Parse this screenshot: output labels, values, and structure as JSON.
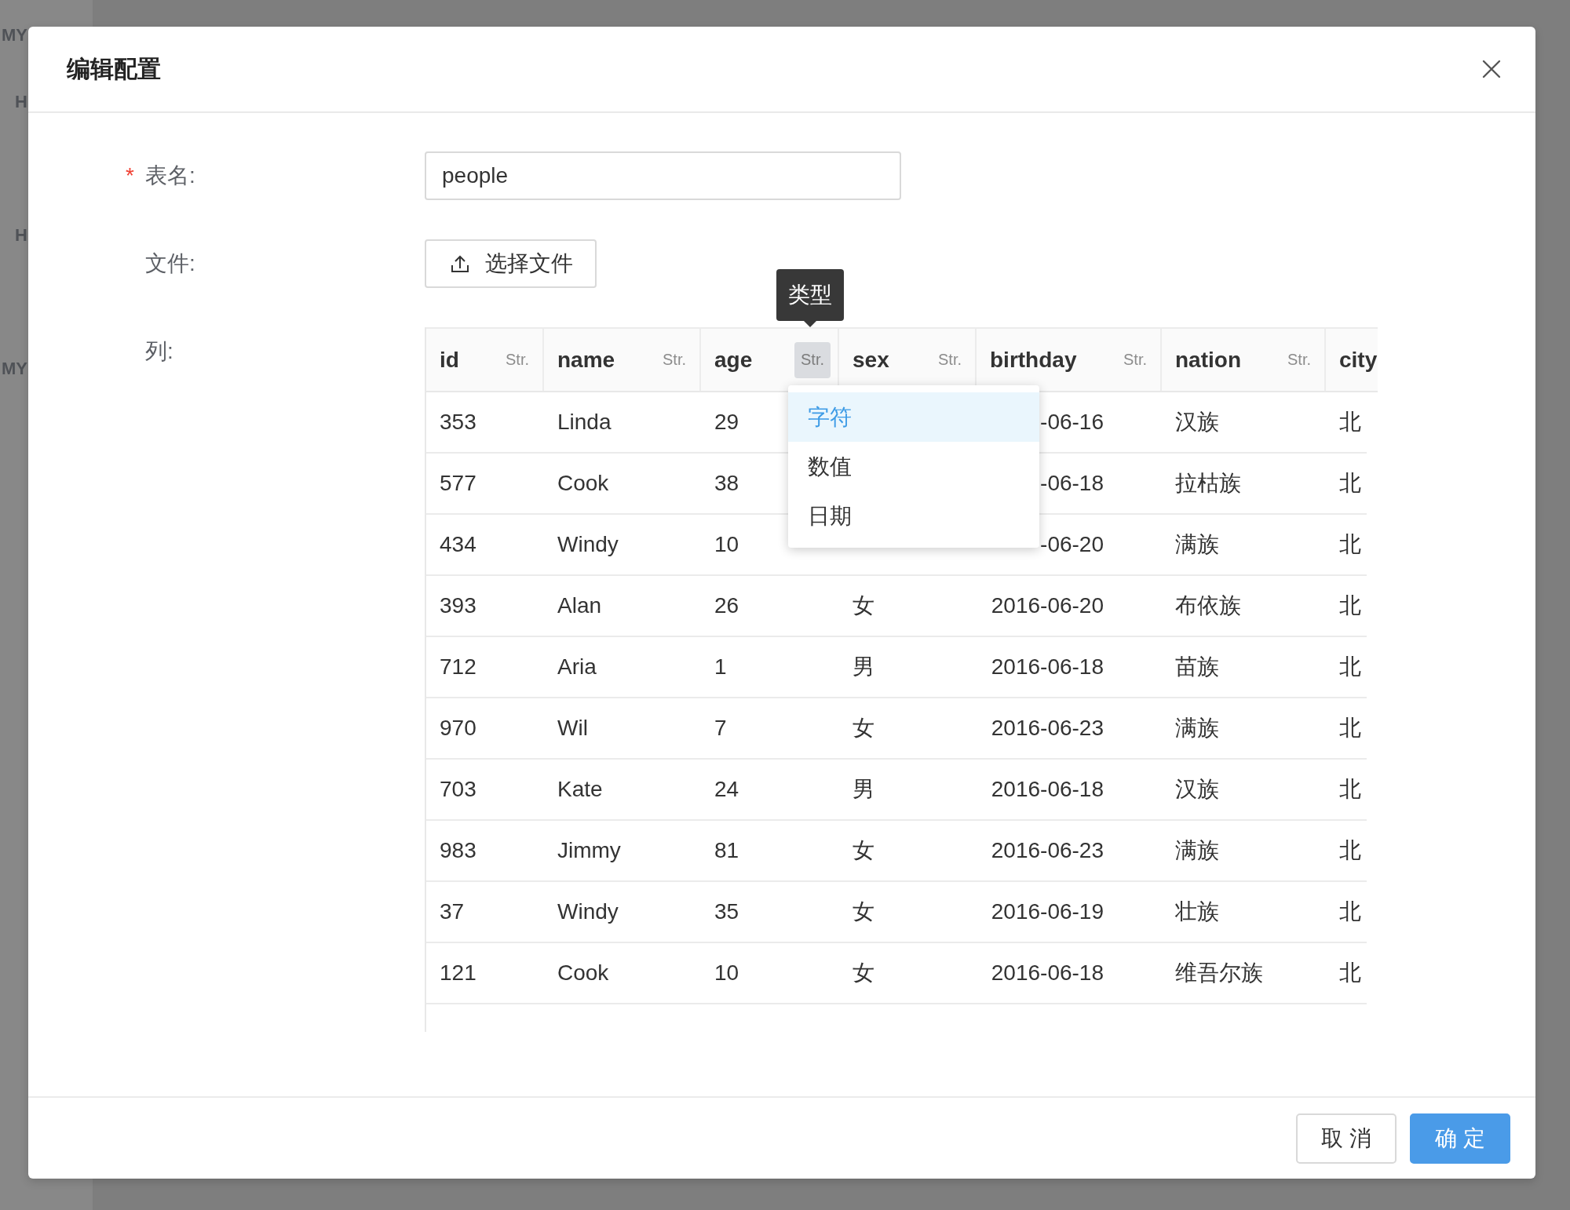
{
  "background": {
    "sidebar": [
      {
        "kind": "heading",
        "label": "MY"
      },
      {
        "kind": "item",
        "label": "H"
      },
      {
        "kind": "item",
        "label": "H"
      },
      {
        "kind": "heading",
        "label": "MY"
      }
    ]
  },
  "dialog": {
    "title": "编辑配置",
    "fields": [
      {
        "kind": "input",
        "required_mark": "*",
        "label": "表名:",
        "value": "people"
      },
      {
        "kind": "upload",
        "label": "文件:",
        "button": "选择文件"
      },
      {
        "kind": "table",
        "label": "列:"
      }
    ],
    "table": {
      "columns": [
        {
          "name": "id",
          "type": "Str.",
          "active": false
        },
        {
          "name": "name",
          "type": "Str.",
          "active": false
        },
        {
          "name": "age",
          "type": "Str.",
          "active": true
        },
        {
          "name": "sex",
          "type": "Str.",
          "active": false
        },
        {
          "name": "birthday",
          "type": "Str.",
          "active": false
        },
        {
          "name": "nation",
          "type": "Str.",
          "active": false
        },
        {
          "name": "city"
        }
      ],
      "rows": [
        [
          "353",
          "Linda",
          "29",
          null,
          "-06-16",
          "汉族",
          "北"
        ],
        [
          "577",
          "Cook",
          "38",
          null,
          "-06-18",
          "拉枯族",
          "北"
        ],
        [
          "434",
          "Windy",
          "10",
          null,
          "-06-20",
          "满族",
          "北"
        ],
        [
          "393",
          "Alan",
          "26",
          "女",
          "2016-06-20",
          "布依族",
          "北"
        ],
        [
          "712",
          "Aria",
          "1",
          "男",
          "2016-06-18",
          "苗族",
          "北"
        ],
        [
          "970",
          "Wil",
          "7",
          "女",
          "2016-06-23",
          "满族",
          "北"
        ],
        [
          "703",
          "Kate",
          "24",
          "男",
          "2016-06-18",
          "汉族",
          "北"
        ],
        [
          "983",
          "Jimmy",
          "81",
          "女",
          "2016-06-23",
          "满族",
          "北"
        ],
        [
          "37",
          "Windy",
          "35",
          "女",
          "2016-06-19",
          "壮族",
          "北"
        ],
        [
          "121",
          "Cook",
          "10",
          "女",
          "2016-06-18",
          "维吾尔族",
          "北"
        ]
      ]
    },
    "type_tooltip": "类型",
    "type_menu": [
      {
        "label": "字符",
        "selected": true
      },
      {
        "label": "数值",
        "selected": false
      },
      {
        "label": "日期",
        "selected": false
      }
    ],
    "buttons": [
      {
        "label": "取 消",
        "kind": "default"
      },
      {
        "label": "确 定",
        "kind": "primary"
      }
    ]
  }
}
